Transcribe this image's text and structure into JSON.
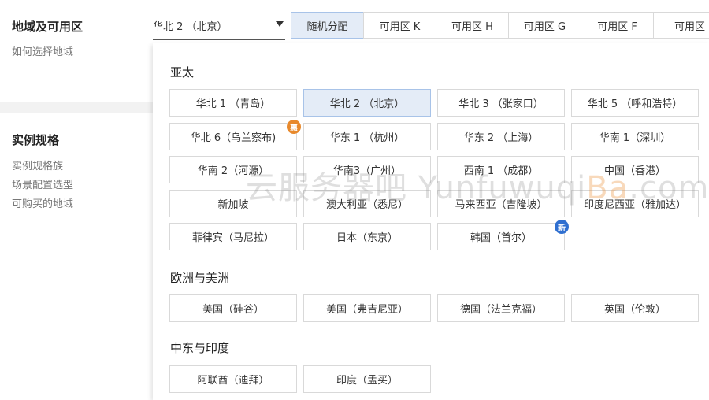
{
  "left_panel": {
    "region_section": {
      "title": "地域及可用区",
      "subtitle": "如何选择地域"
    },
    "spec_section": {
      "title": "实例规格",
      "links": [
        "实例规格族",
        "场景配置选型",
        "可购买的地域"
      ]
    }
  },
  "region_select": {
    "value": "华北 2 （北京）",
    "icon": "caret-down-icon"
  },
  "zone_tabs": [
    "随机分配",
    "可用区 K",
    "可用区 H",
    "可用区 G",
    "可用区 F",
    "可用区"
  ],
  "active_zone_tab": "随机分配",
  "dropdown": {
    "selected": "华北 2 （北京）",
    "groups": [
      {
        "title": "亚太",
        "options": [
          {
            "label": "华北 1 （青岛）"
          },
          {
            "label": "华北 2 （北京）"
          },
          {
            "label": "华北 3 （张家口）"
          },
          {
            "label": "华北 5 （呼和浩特）"
          },
          {
            "label": "华北 6（乌兰察布)",
            "badge": "惠",
            "badge_color": "#e8892c"
          },
          {
            "label": "华东 1 （杭州）"
          },
          {
            "label": "华东 2 （上海）"
          },
          {
            "label": "华南 1（深圳）"
          },
          {
            "label": "华南 2（河源）"
          },
          {
            "label": "华南3（广州）"
          },
          {
            "label": "西南 1 （成都）"
          },
          {
            "label": "中国（香港）"
          },
          {
            "label": "新加坡"
          },
          {
            "label": "澳大利亚（悉尼）"
          },
          {
            "label": "马来西亚（吉隆坡）"
          },
          {
            "label": "印度尼西亚（雅加达）"
          },
          {
            "label": "菲律宾（马尼拉）"
          },
          {
            "label": "日本（东京）"
          },
          {
            "label": "韩国（首尔）",
            "badge": "新",
            "badge_color": "#2f6fd0"
          }
        ]
      },
      {
        "title": "欧洲与美洲",
        "options": [
          {
            "label": "美国（硅谷）"
          },
          {
            "label": "美国（弗吉尼亚）"
          },
          {
            "label": "德国（法兰克福）"
          },
          {
            "label": "英国（伦敦）"
          }
        ]
      },
      {
        "title": "中东与印度",
        "options": [
          {
            "label": "阿联酋（迪拜）"
          },
          {
            "label": "印度（孟买）"
          }
        ]
      }
    ]
  },
  "watermark": {
    "text_cn": "云服务器吧 ",
    "text_a": "Yunfuwuqi",
    "text_b": "Ba",
    "text_c": ".com"
  },
  "colors": {
    "selected_bg": "#e4ecf7",
    "selected_border": "#a8c3e8",
    "badge_hui": "#e8892c",
    "badge_xin": "#2f6fd0"
  }
}
